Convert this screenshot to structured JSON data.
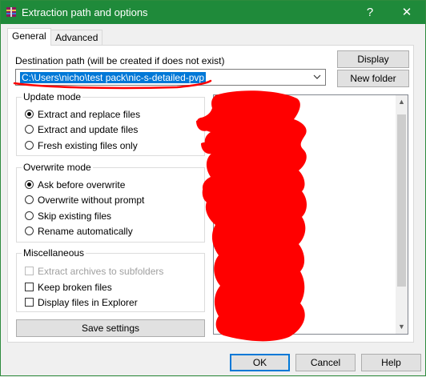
{
  "window": {
    "title": "Extraction path and options",
    "help_label": "?",
    "close_label": "✕",
    "title_color": "#1f8a3a"
  },
  "tabs": [
    {
      "label": "General",
      "active": true
    },
    {
      "label": "Advanced",
      "active": false
    }
  ],
  "destination": {
    "label": "Destination path (will be created if does not exist)",
    "value": "C:\\Users\\nicho\\test pack\\nic-s-detailed-pvp",
    "display_button": "Display",
    "new_folder_button": "New folder"
  },
  "update_mode": {
    "title": "Update mode",
    "options": [
      {
        "label": "Extract and replace files",
        "selected": true
      },
      {
        "label": "Extract and update files",
        "selected": false
      },
      {
        "label": "Fresh existing files only",
        "selected": false
      }
    ]
  },
  "overwrite_mode": {
    "title": "Overwrite mode",
    "options": [
      {
        "label": "Ask before overwrite",
        "selected": true
      },
      {
        "label": "Overwrite without prompt",
        "selected": false
      },
      {
        "label": "Skip existing files",
        "selected": false
      },
      {
        "label": "Rename automatically",
        "selected": false
      }
    ]
  },
  "misc": {
    "title": "Miscellaneous",
    "options": [
      {
        "label": "Extract archives to subfolders",
        "checked": false,
        "disabled": true
      },
      {
        "label": "Keep broken files",
        "checked": false,
        "disabled": false
      },
      {
        "label": "Display files in Explorer",
        "checked": false,
        "disabled": false
      }
    ]
  },
  "save_settings_button": "Save settings",
  "footer": {
    "ok": "OK",
    "cancel": "Cancel",
    "help": "Help"
  },
  "colors": {
    "selection": "#0078d7",
    "scribble": "#ff0000"
  }
}
